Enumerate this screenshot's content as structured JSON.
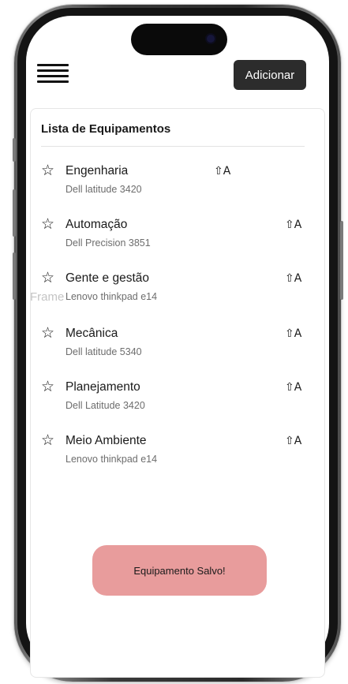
{
  "header": {
    "menu_icon": "hamburger-menu-icon",
    "add_button_label": "Adicionar"
  },
  "list": {
    "title": "Lista de Equipamentos",
    "items": [
      {
        "department": "Engenharia",
        "model": "Dell latitude 3420",
        "sort_label": "⇧A"
      },
      {
        "department": "Automação",
        "model": "Dell Precision 3851",
        "sort_label": "⇧A"
      },
      {
        "department": "Gente e gestão",
        "model": "Lenovo thinkpad e14",
        "sort_label": "⇧A"
      },
      {
        "department": "Mecânica",
        "model": "Dell latitude 5340",
        "sort_label": "⇧A"
      },
      {
        "department": "Planejamento",
        "model": "Dell Latitude 3420",
        "sort_label": "⇧A"
      },
      {
        "department": "Meio Ambiente",
        "model": "Lenovo thinkpad e14",
        "sort_label": "⇧A"
      }
    ]
  },
  "frame_label": "Frame",
  "toast": {
    "message": "Equipamento Salvo!",
    "color": "#e89c9c"
  },
  "icons": {
    "favorite": "star-outline-icon",
    "sort": "shift-arrow-up-icon"
  }
}
